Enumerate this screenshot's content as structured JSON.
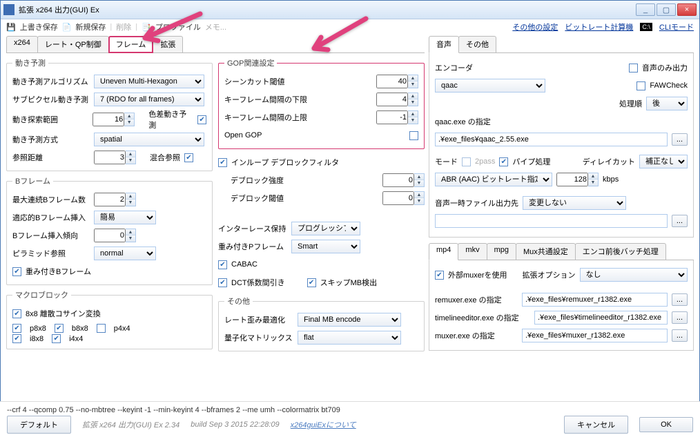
{
  "window": {
    "title": "拡張 x264 出力(GUI) Ex",
    "min": "_",
    "max": "▢",
    "close": "×"
  },
  "toolbar": {
    "overwrite": "上書き保存",
    "new": "新規保存",
    "del": "削除",
    "profile": "プロファイル",
    "memo": "メモ...",
    "other": "その他の設定",
    "bitcalc": "ビットレート計算機",
    "cli": "CLIモード"
  },
  "leftTabs": [
    "x264",
    "レート・QP制御",
    "フレーム",
    "拡張"
  ],
  "me": {
    "legend": "動き予測",
    "algLabel": "動き予測アルゴリズム",
    "alg": "Uneven Multi-Hexagon",
    "subLabel": "サブピクセル動き予測",
    "sub": "7 (RDO for all frames)",
    "rangeLabel": "動き探索範囲",
    "range": "16",
    "chromaLabel": "色差動き予測",
    "methodLabel": "動き予測方式",
    "method": "spatial",
    "refLabel": "参照距離",
    "ref": "3",
    "mixLabel": "混合参照"
  },
  "gop": {
    "legend": "GOP関連設定",
    "scLabel": "シーンカット閾値",
    "sc": "40",
    "minLabel": "キーフレーム間隔の下限",
    "min": "4",
    "maxLabel": "キーフレーム間隔の上限",
    "max": "-1",
    "openLabel": "Open GOP"
  },
  "deblock": {
    "inloop": "インループ デブロックフィルタ",
    "strengthLabel": "デブロック強度",
    "strength": "0",
    "threshLabel": "デブロック閾値",
    "thresh": "0"
  },
  "bframe": {
    "legend": "Bフレーム",
    "maxLabel": "最大連続Bフレーム数",
    "max": "2",
    "adaptLabel": "適応的Bフレーム挿入",
    "adapt": "簡易",
    "biasLabel": "Bフレーム挿入傾向",
    "bias": "0",
    "pyrLabel": "ピラミッド参照",
    "pyr": "normal",
    "wbLabel": "重み付きBフレーム"
  },
  "misc": {
    "interLabel": "インターレース保持",
    "inter": "プログレッシブ",
    "wpLabel": "重み付きPフレーム",
    "wp": "Smart",
    "cabac": "CABAC",
    "dct": "DCT係数間引き",
    "skip": "スキップMB検出"
  },
  "mb": {
    "legend": "マクロブロック",
    "dct88": "8x8 離散コサイン変換",
    "p8x8": "p8x8",
    "b8x8": "b8x8",
    "p4x4": "p4x4",
    "i8x8": "i8x8",
    "i4x4": "i4x4"
  },
  "other": {
    "legend": "その他",
    "rdLabel": "レート歪み最適化",
    "rd": "Final MB encode",
    "cqmLabel": "量子化マトリックス",
    "cqm": "flat"
  },
  "audioTabs": [
    "音声",
    "その他"
  ],
  "audio": {
    "encLabel": "エンコーダ",
    "enc": "qaac",
    "onlyAudio": "音声のみ出力",
    "faw": "FAWCheck",
    "orderLabel": "処理順",
    "order": "後",
    "exeLabel": "qaac.exe の指定",
    "exe": ".¥exe_files¥qaac_2.55.exe",
    "modeLabel": "モード",
    "twopass": "2pass",
    "pipe": "パイプ処理",
    "bitrate": "128",
    "kbps": "kbps",
    "delayLabel": "ディレイカット",
    "delay": "補正なし",
    "modeSel": "ABR (AAC) ビットレート指定",
    "tmpLabel": "音声一時ファイル出力先",
    "tmp": "変更しない"
  },
  "muxTabs": [
    "mp4",
    "mkv",
    "mpg",
    "Mux共通設定",
    "エンコ前後バッチ処理"
  ],
  "mux": {
    "extMux": "外部muxerを使用",
    "extOptLabel": "拡張オプション",
    "extOpt": "なし",
    "remuxLabel": "remuxer.exe の指定",
    "remux": ".¥exe_files¥remuxer_r1382.exe",
    "tlLabel": "timelineeditor.exe の指定",
    "tl": ".¥exe_files¥timelineeditor_r1382.exe",
    "muxLabel": "muxer.exe の指定",
    "muxexe": ".¥exe_files¥muxer_r1382.exe"
  },
  "cmdline": "--crf 4 --qcomp 0.75 --no-mbtree --keyint -1 --min-keyint 4 --bframes 2 --me umh --colormatrix bt709",
  "buttons": {
    "default": "デフォルト",
    "cancel": "キャンセル",
    "ok": "OK"
  },
  "info": {
    "ver": "拡張 x264 出力(GUI) Ex 2.34",
    "build": "build Sep  3 2015 22:28:09",
    "link": "x264guiExについて"
  }
}
